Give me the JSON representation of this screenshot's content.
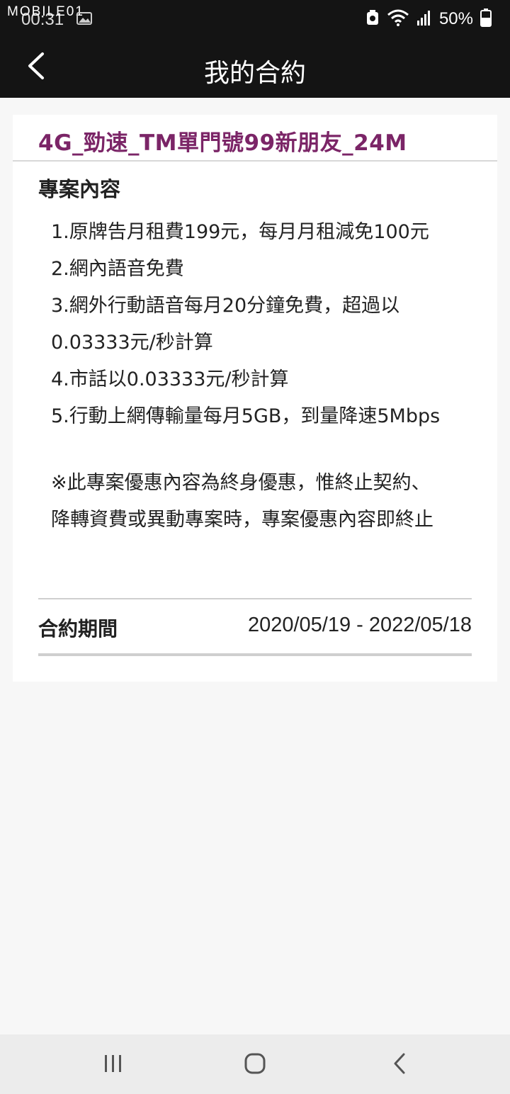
{
  "status_bar": {
    "watermark": "MOBILE01",
    "time": "00:31",
    "battery": "50%",
    "icons": [
      "image-icon",
      "recycle-icon",
      "wifi-icon",
      "signal-icon",
      "battery-icon"
    ]
  },
  "header": {
    "title": "我的合約",
    "back_icon": "chevron-left-icon"
  },
  "contract": {
    "plan_name": "4G_勁速_TM單門號99新朋友_24M",
    "section_heading": "專案內容",
    "content_lines": [
      "1.原牌告月租費199元，每月月租減免100元",
      "2.網內語音免費",
      "3.網外行動語音每月20分鐘免費，超過以",
      "0.03333元/秒計算",
      "4.市話以0.03333元/秒計算",
      "5.行動上網傳輸量每月5GB，到量降速5Mbps"
    ],
    "note_lines": [
      "※此專案優惠內容為終身優惠，惟終止契約、",
      "降轉資費或異動專案時，專案優惠內容即終止"
    ],
    "period_label": "合約期間",
    "period_value": "2020/05/19 - 2022/05/18"
  },
  "nav_bar": {
    "icons": [
      "recent-apps-icon",
      "home-icon",
      "back-icon"
    ]
  },
  "colors": {
    "header_bg": "#141414",
    "plan_title": "#7b2567",
    "page_bg": "#f7f7f7",
    "card_bg": "#ffffff"
  }
}
